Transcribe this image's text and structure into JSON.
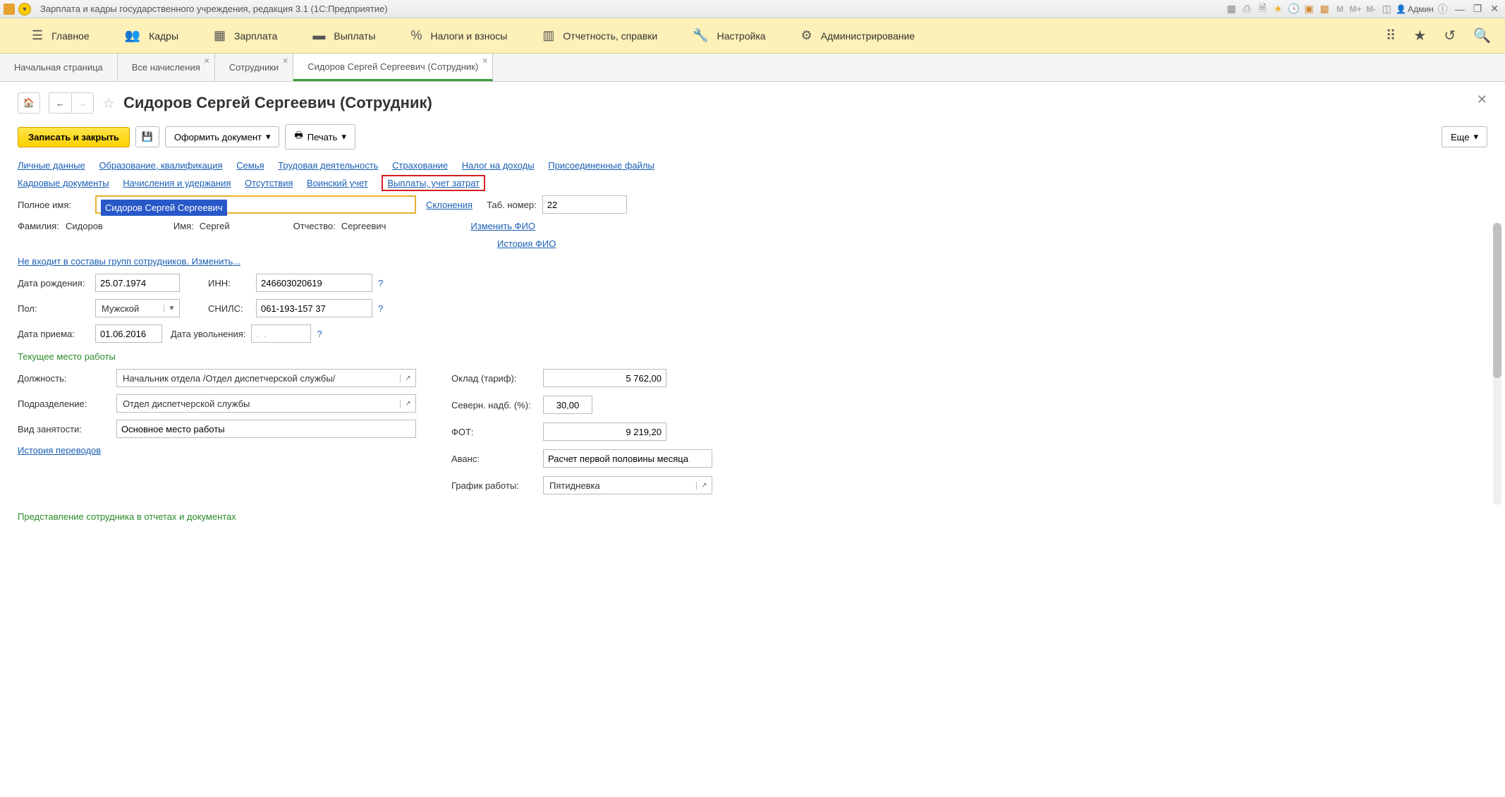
{
  "titlebar": {
    "title": "Зарплата и кадры государственного учреждения, редакция 3.1  (1С:Предприятие)",
    "user_label": "Админ"
  },
  "mainmenu": {
    "items": [
      {
        "label": "Главное"
      },
      {
        "label": "Кадры"
      },
      {
        "label": "Зарплата"
      },
      {
        "label": "Выплаты"
      },
      {
        "label": "Налоги и взносы"
      },
      {
        "label": "Отчетность, справки"
      },
      {
        "label": "Настройка"
      },
      {
        "label": "Администрирование"
      }
    ]
  },
  "tabs": [
    {
      "label": "Начальная страница",
      "closable": false,
      "active": false
    },
    {
      "label": "Все начисления",
      "closable": true,
      "active": false
    },
    {
      "label": "Сотрудники",
      "closable": true,
      "active": false
    },
    {
      "label": "Сидоров Сергей Сергеевич (Сотрудник)",
      "closable": true,
      "active": true
    }
  ],
  "page": {
    "title": "Сидоров Сергей Сергеевич (Сотрудник)",
    "save_close": "Записать и закрыть",
    "create_doc": "Оформить документ",
    "print": "Печать",
    "more": "Еще"
  },
  "links": {
    "personal": "Личные данные",
    "education": "Образование, квалификация",
    "family": "Семья",
    "work_activity": "Трудовая деятельность",
    "insurance": "Страхование",
    "income_tax": "Налог на доходы",
    "attached_files": "Присоединенные файлы",
    "hr_docs": "Кадровые документы",
    "accruals": "Начисления и удержания",
    "absences": "Отсутствия",
    "military": "Воинский учет",
    "payments_costs": "Выплаты, учет затрат"
  },
  "form": {
    "fullname_label": "Полное имя:",
    "fullname_value": "Сидоров Сергей Сергеевич",
    "declensions": "Склонения",
    "tabnum_label": "Таб. номер:",
    "tabnum_value": "22",
    "surname_label": "Фамилия:",
    "surname_value": "Сидоров",
    "name_label": "Имя:",
    "name_value": "Сергей",
    "patronymic_label": "Отчество:",
    "patronymic_value": "Сергеевич",
    "change_fio": "Изменить ФИО",
    "history_fio": "История ФИО",
    "groups_link": "Не входит в составы групп сотрудников. Изменить...",
    "birthdate_label": "Дата рождения:",
    "birthdate_value": "25.07.1974",
    "inn_label": "ИНН:",
    "inn_value": "246603020619",
    "gender_label": "Пол:",
    "gender_value": "Мужской",
    "snils_label": "СНИЛС:",
    "snils_value": "061-193-157 37",
    "hire_date_label": "Дата приема:",
    "hire_date_value": "01.06.2016",
    "fire_date_label": "Дата увольнения:",
    "fire_date_value": ".  .",
    "workplace_header": "Текущее место работы",
    "position_label": "Должность:",
    "position_value": "Начальник отдела /Отдел диспетчерской службы/",
    "department_label": "Подразделение:",
    "department_value": "Отдел диспетчерской службы",
    "employment_label": "Вид занятости:",
    "employment_value": "Основное место работы",
    "transfers_history": "История переводов",
    "salary_label": "Оклад (тариф):",
    "salary_value": "5 762,00",
    "north_label": "Северн. надб. (%):",
    "north_value": "30,00",
    "fot_label": "ФОТ:",
    "fot_value": "9 219,20",
    "advance_label": "Аванс:",
    "advance_value": "Расчет первой половины месяца",
    "schedule_label": "График работы:",
    "schedule_value": "Пятидневка",
    "representation_header": "Представление сотрудника в отчетах и документах"
  }
}
